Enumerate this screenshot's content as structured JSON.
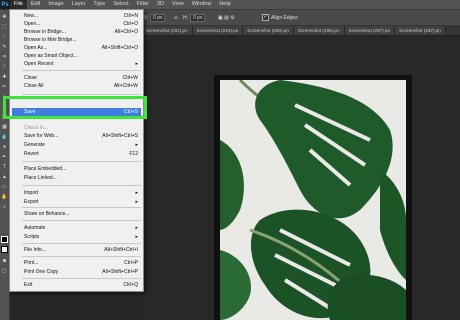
{
  "menubar": {
    "logo": "Ps",
    "items": [
      "File",
      "Edit",
      "Image",
      "Layer",
      "Type",
      "Select",
      "Filter",
      "3D",
      "View",
      "Window",
      "Help"
    ]
  },
  "options": {
    "w_label": "W:",
    "w_value": "0 px",
    "h_label": "H:",
    "h_value": "0 px",
    "align_edges": "Align Edges"
  },
  "tabs": [
    "Screenshot (291).pn",
    "Screenshot (294).pn",
    "Screenshot (290).pn",
    "Screenshot (296).pn",
    "Screenshot (297).pn",
    "Screenshot (287).pn"
  ],
  "file_menu": {
    "items": [
      {
        "label": "New...",
        "shortcut": "Ctrl+N"
      },
      {
        "label": "Open...",
        "shortcut": "Ctrl+O"
      },
      {
        "label": "Browse in Bridge...",
        "shortcut": "Alt+Ctrl+O"
      },
      {
        "label": "Browse in Mini Bridge...",
        "shortcut": ""
      },
      {
        "label": "Open As...",
        "shortcut": "Alt+Shift+Ctrl+O"
      },
      {
        "label": "Open as Smart Object...",
        "shortcut": ""
      },
      {
        "label": "Open Recent",
        "shortcut": ""
      },
      {
        "label": "Close",
        "shortcut": "Ctrl+W"
      },
      {
        "label": "Close All",
        "shortcut": "Alt+Ctrl+W"
      },
      {
        "label": "Save",
        "shortcut": "Ctrl+S"
      },
      {
        "label": "Check In...",
        "shortcut": ""
      },
      {
        "label": "Save for Web...",
        "shortcut": "Alt+Shift+Ctrl+S"
      },
      {
        "label": "Generate",
        "shortcut": ""
      },
      {
        "label": "Revert",
        "shortcut": "F12"
      },
      {
        "label": "Place Embedded...",
        "shortcut": ""
      },
      {
        "label": "Place Linked...",
        "shortcut": ""
      },
      {
        "label": "Import",
        "shortcut": ""
      },
      {
        "label": "Export",
        "shortcut": ""
      },
      {
        "label": "Share on Behance...",
        "shortcut": ""
      },
      {
        "label": "Automate",
        "shortcut": ""
      },
      {
        "label": "Scripts",
        "shortcut": ""
      },
      {
        "label": "File Info...",
        "shortcut": "Alt+Shift+Ctrl+I"
      },
      {
        "label": "Print...",
        "shortcut": "Ctrl+P"
      },
      {
        "label": "Print One Copy",
        "shortcut": "Alt+Shift+Ctrl+P"
      },
      {
        "label": "Exit",
        "shortcut": "Ctrl+Q"
      }
    ]
  },
  "colors": {
    "highlight": "#3ee63a",
    "selection": "#3d7ee0",
    "menu_bg": "#f0f0f0"
  }
}
